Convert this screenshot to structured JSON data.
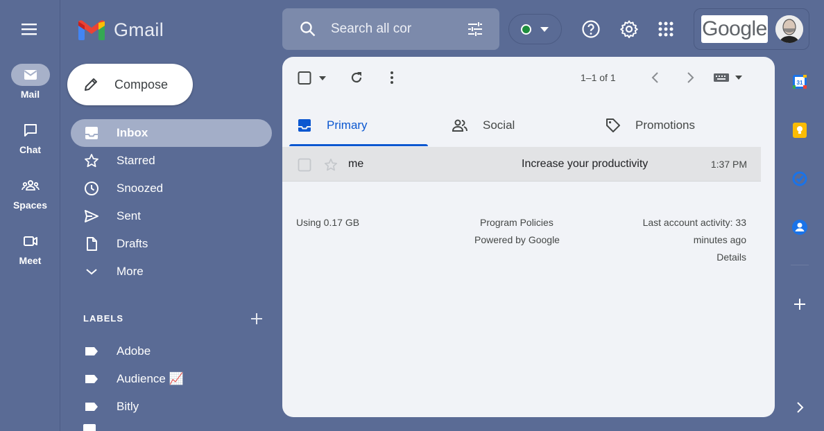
{
  "app": {
    "name": "Gmail"
  },
  "rail": {
    "items": [
      {
        "label": "Mail",
        "icon": "mail-icon",
        "active": true
      },
      {
        "label": "Chat",
        "icon": "chat-icon"
      },
      {
        "label": "Spaces",
        "icon": "spaces-icon"
      },
      {
        "label": "Meet",
        "icon": "meet-icon"
      }
    ]
  },
  "compose": {
    "label": "Compose"
  },
  "nav": {
    "items": [
      {
        "label": "Inbox",
        "icon": "inbox-icon",
        "active": true
      },
      {
        "label": "Starred",
        "icon": "star-icon"
      },
      {
        "label": "Snoozed",
        "icon": "clock-icon"
      },
      {
        "label": "Sent",
        "icon": "send-icon"
      },
      {
        "label": "Drafts",
        "icon": "draft-icon"
      },
      {
        "label": "More",
        "icon": "chevron-down-icon"
      }
    ]
  },
  "labels": {
    "heading": "LABELS",
    "items": [
      {
        "label": "Adobe"
      },
      {
        "label": "Audience 📈"
      },
      {
        "label": "Bitly"
      }
    ]
  },
  "search": {
    "value": "Search all cor"
  },
  "account": {
    "brand": "Google"
  },
  "toolbar": {
    "page_count": "1–1 of 1"
  },
  "tabs": [
    {
      "label": "Primary",
      "icon": "inbox-icon",
      "active": true
    },
    {
      "label": "Social",
      "icon": "people-icon"
    },
    {
      "label": "Promotions",
      "icon": "tag-icon"
    }
  ],
  "messages": [
    {
      "sender": "me",
      "subject": "Increase your productivity",
      "time": "1:37 PM"
    }
  ],
  "footer": {
    "storage": "Using 0.17 GB",
    "policies": "Program Policies",
    "powered": "Powered by Google",
    "activity_line1": "Last account activity: 33",
    "activity_line2": "minutes ago",
    "details": "Details"
  },
  "colors": {
    "background": "#5a6b95",
    "panel": "#f1f3f7",
    "accent": "#0b57d0",
    "status_online": "#1e8e3e"
  }
}
